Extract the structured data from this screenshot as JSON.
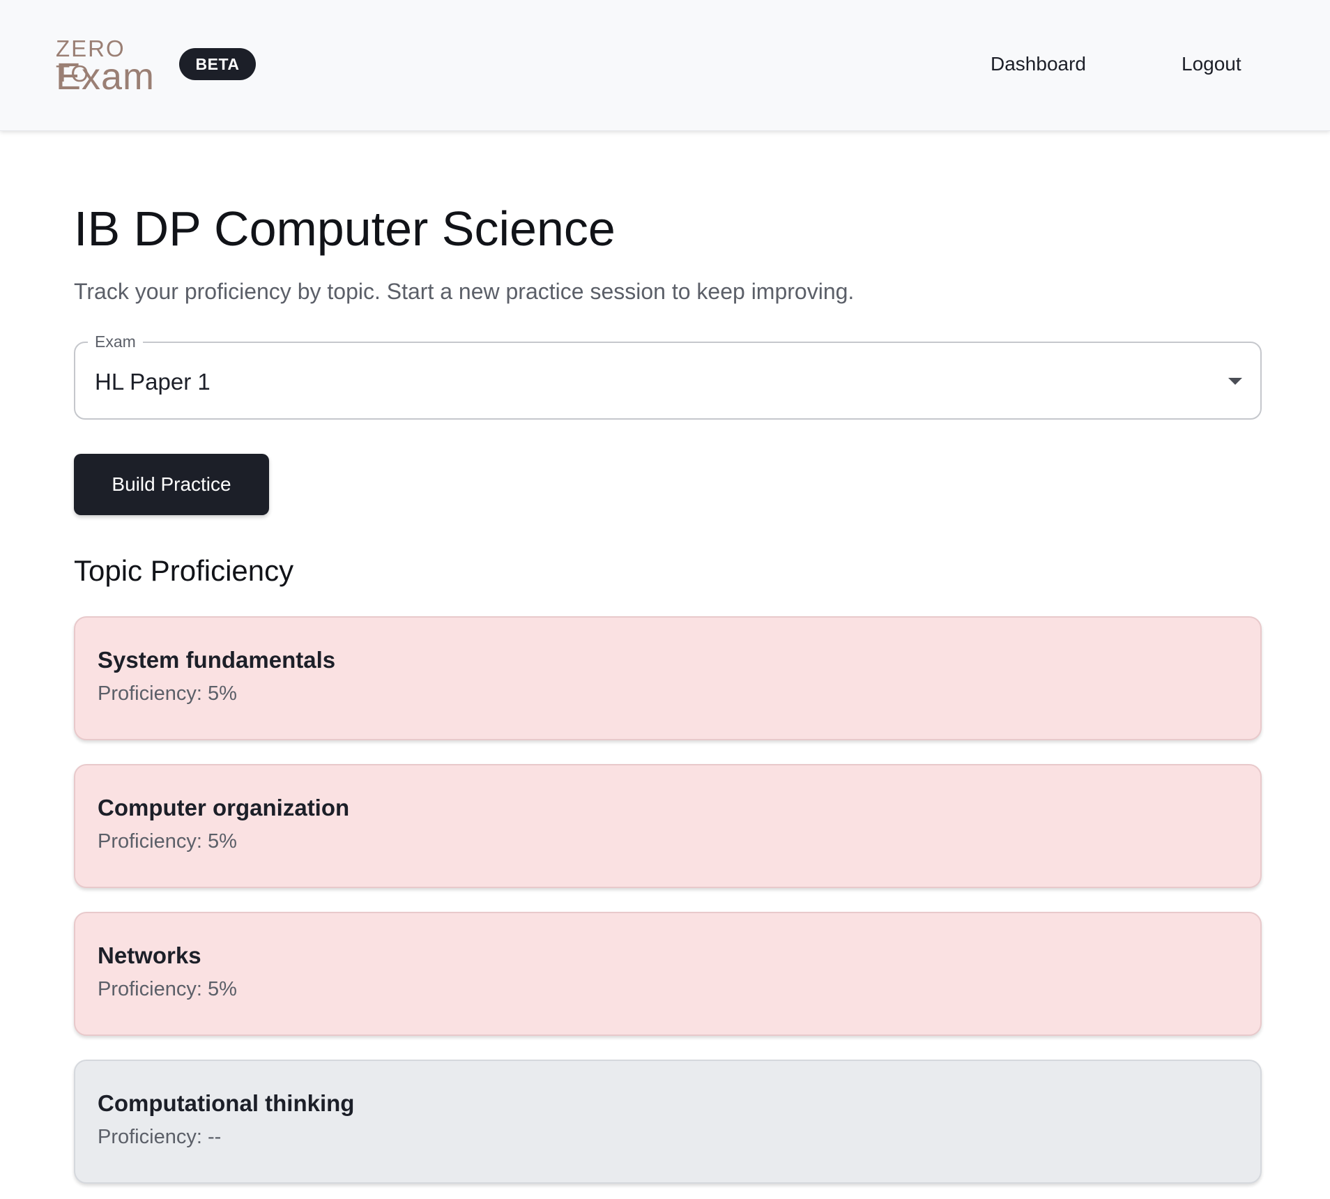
{
  "header": {
    "logo_top": "ZERO TO",
    "logo_bottom": "Exam",
    "beta_badge": "BETA",
    "nav": [
      {
        "label": "Dashboard"
      },
      {
        "label": "Logout"
      }
    ]
  },
  "page": {
    "title": "IB DP Computer Science",
    "subtitle": "Track your proficiency by topic. Start a new practice session to keep improving."
  },
  "exam_select": {
    "label": "Exam",
    "value": "HL Paper 1"
  },
  "build_button": {
    "label": "Build Practice"
  },
  "topics_section": {
    "title": "Topic Proficiency",
    "topics": [
      {
        "name": "System fundamentals",
        "proficiency": "Proficiency: 5%",
        "level": 0.05,
        "status_color": "#fae1e2"
      },
      {
        "name": "Computer organization",
        "proficiency": "Proficiency: 5%",
        "level": 0.05,
        "status_color": "#fae1e2"
      },
      {
        "name": "Networks",
        "proficiency": "Proficiency: 5%",
        "level": 0.05,
        "status_color": "#fae1e2"
      },
      {
        "name": "Computational thinking",
        "proficiency": "Proficiency: --",
        "level": null,
        "status_color": "#e9ebee"
      }
    ]
  },
  "colors": {
    "brand_dark": "#1c1f28",
    "logo": "#9a7f74",
    "low_proficiency": "#fae1e2",
    "no_data": "#e9ebee"
  }
}
